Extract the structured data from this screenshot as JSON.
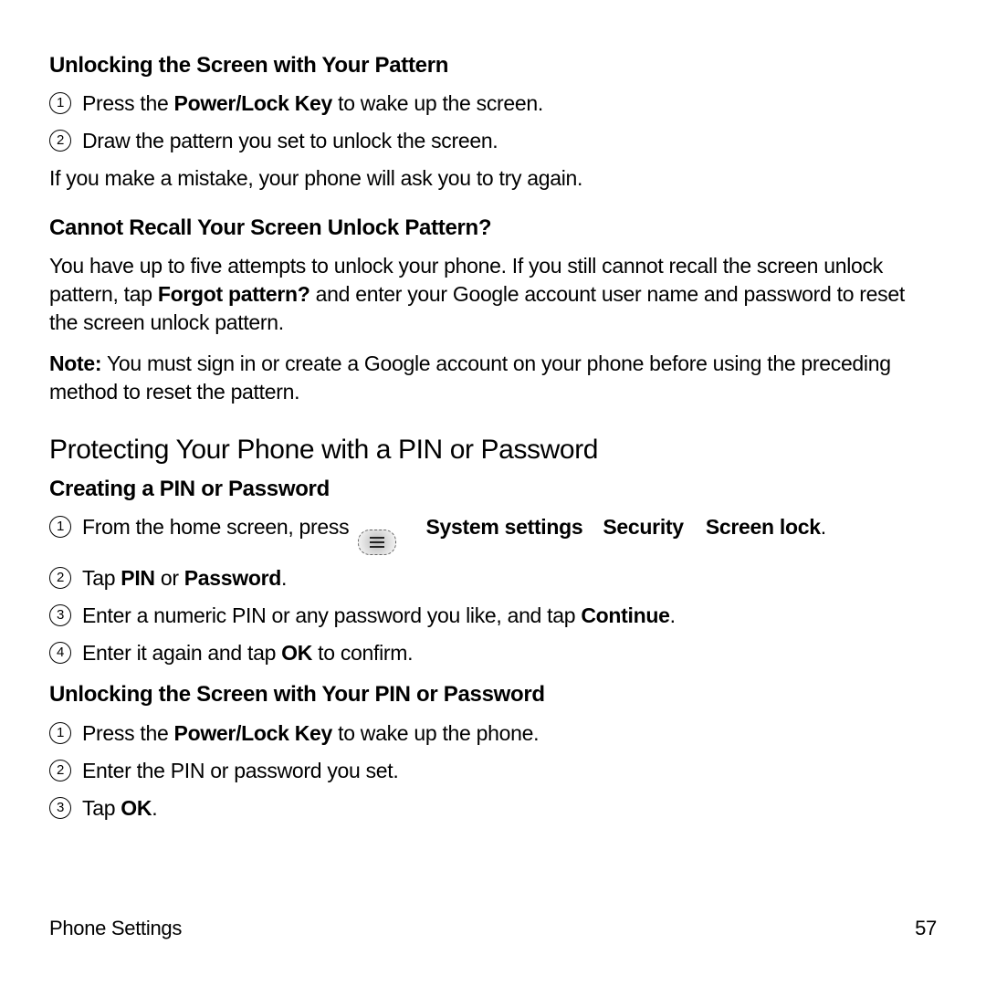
{
  "section1": {
    "heading": "Unlocking the Screen with Your Pattern",
    "step1_pre": "Press the ",
    "step1_bold": "Power/Lock Key",
    "step1_post": " to wake up the screen.",
    "step2": "Draw the pattern you set to unlock the screen.",
    "note": "If you make a mistake, your phone will ask you to try again."
  },
  "section2": {
    "heading": "Cannot Recall Your Screen Unlock Pattern?",
    "p1_pre": "You have up to five attempts to unlock your phone. If you still cannot recall the screen unlock pattern, tap ",
    "p1_bold": "Forgot pattern?",
    "p1_post": " and enter your Google account user name and password to reset the screen unlock pattern.",
    "p2_bold": "Note:",
    "p2_post": " You must sign in or create a Google account on your phone before using the preceding method to reset the pattern."
  },
  "section3": {
    "heading": "Protecting Your Phone with a PIN or Password",
    "sub1": "Creating a PIN or Password",
    "s1_step1_pre": "From the home screen, press",
    "s1_step1_b1": "System settings",
    "s1_step1_b2": "Security",
    "s1_step1_b3": "Screen lock",
    "s1_step1_post": ".",
    "s1_step2_pre": "Tap ",
    "s1_step2_b1": "PIN",
    "s1_step2_mid": " or ",
    "s1_step2_b2": "Password",
    "s1_step2_post": ".",
    "s1_step3_pre": "Enter a numeric PIN or any password you like, and tap ",
    "s1_step3_b": "Continue",
    "s1_step3_post": ".",
    "s1_step4_pre": "Enter it again and tap ",
    "s1_step4_b": "OK",
    "s1_step4_post": " to confirm.",
    "sub2": "Unlocking the Screen with Your PIN or Password",
    "s2_step1_pre": "Press the ",
    "s2_step1_b": "Power/Lock Key",
    "s2_step1_post": " to wake up the phone.",
    "s2_step2": "Enter the PIN or password you set.",
    "s2_step3_pre": "Tap ",
    "s2_step3_b": "OK",
    "s2_step3_post": "."
  },
  "footer": {
    "left": "Phone Settings",
    "right": "57"
  }
}
